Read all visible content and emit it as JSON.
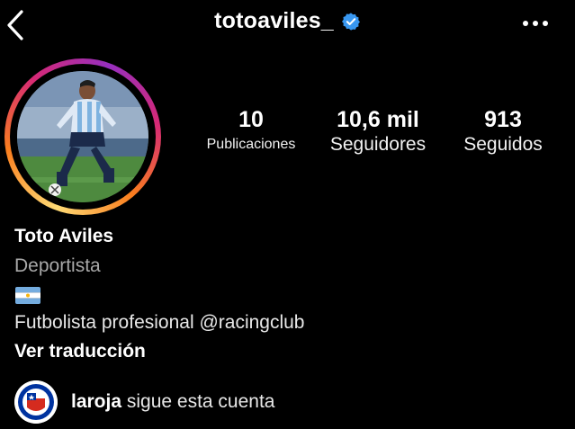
{
  "header": {
    "username": "totoaviles_",
    "verified": true,
    "back_icon": "chevron-left-icon",
    "more_icon": "more-horizontal-icon"
  },
  "profile": {
    "avatar": "profile-photo",
    "has_story_ring": true
  },
  "stats": [
    {
      "value": "10",
      "label": "Publicaciones"
    },
    {
      "value": "10,6 mil",
      "label": "Seguidores"
    },
    {
      "value": "913",
      "label": "Seguidos"
    }
  ],
  "bio": {
    "name": "Toto Aviles",
    "category": "Deportista",
    "flag_emoji": "argentina-flag",
    "text": "Futbolista profesional @racingclub",
    "translate": "Ver traducción"
  },
  "followed_by": {
    "account": "laroja",
    "text": " sigue esta cuenta"
  },
  "colors": {
    "background": "#000000",
    "text": "#ffffff",
    "secondary": "#a8a8a8",
    "verified": "#3897f0"
  }
}
